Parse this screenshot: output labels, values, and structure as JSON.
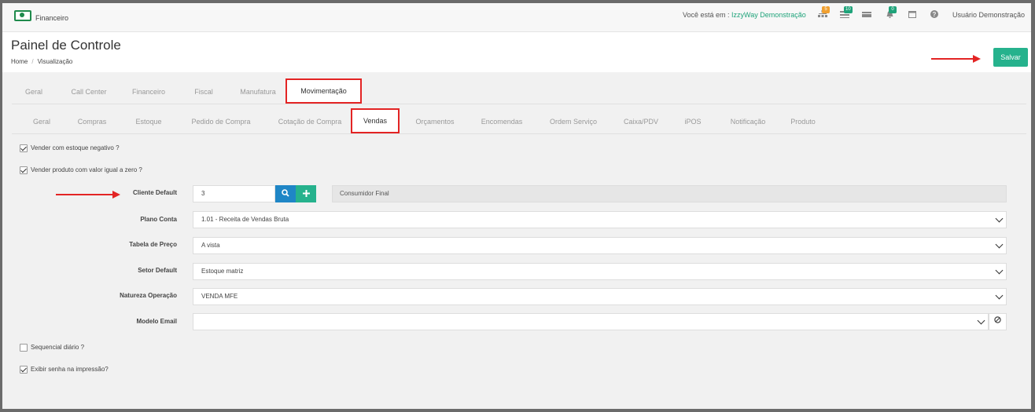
{
  "topbar": {
    "app_name": "Financeiro",
    "location_prefix": "Você está em : ",
    "company": "IzzyWay Demonstração",
    "badges": [
      "5",
      "10",
      "0"
    ],
    "user": "Usuário Demonstração",
    "icons": [
      "sitemap-icon",
      "list-icon",
      "card-icon",
      "bell-icon",
      "calendar-icon",
      "help-icon"
    ],
    "badge_colors": [
      "#f0a030",
      "#1fa37a",
      "#1fa37a"
    ]
  },
  "header": {
    "title": "Painel de Controle",
    "breadcrumb": [
      "Home",
      "Visualização"
    ],
    "save_label": "Salvar"
  },
  "tabs_primary": [
    "Geral",
    "Call Center",
    "Financeiro",
    "Fiscal",
    "Manufatura",
    "Movimentação"
  ],
  "tabs_primary_active": "Movimentação",
  "tabs_secondary": [
    "Geral",
    "Compras",
    "Estoque",
    "Pedido de Compra",
    "Cotação de Compra",
    "Vendas",
    "Orçamentos",
    "Encomendas",
    "Ordem Serviço",
    "Caixa/PDV",
    "iPOS",
    "Notificação",
    "Produto"
  ],
  "tabs_secondary_active": "Vendas",
  "checks": {
    "estoque_negativo": {
      "label": "Vender com estoque negativo ?",
      "checked": true
    },
    "valor_zero": {
      "label": "Vender produto com valor igual a zero ?",
      "checked": true
    },
    "sequencial": {
      "label": "Sequencial diário ?",
      "checked": false
    },
    "senha": {
      "label": "Exibir senha na impressão?",
      "checked": true
    }
  },
  "form": {
    "cliente_default": {
      "label": "Cliente Default",
      "value": "3",
      "description": "Consumidor Final"
    },
    "plano_conta": {
      "label": "Plano Conta",
      "value": "1.01 - Receita de Vendas Bruta"
    },
    "tabela_preco": {
      "label": "Tabela de Preço",
      "value": "A vista"
    },
    "setor_default": {
      "label": "Setor Default",
      "value": "Estoque matriz"
    },
    "natureza_operacao": {
      "label": "Natureza Operação",
      "value": "VENDA MFE"
    },
    "modelo_email": {
      "label": "Modelo Email",
      "value": ""
    }
  },
  "colors": {
    "accent": "#26b28d",
    "primary": "#1f86c6",
    "annotation": "#e32424"
  }
}
